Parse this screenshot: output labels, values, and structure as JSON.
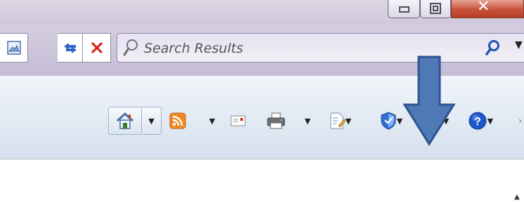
{
  "search": {
    "placeholder": "Search Results"
  },
  "colors": {
    "accent_arrow": "#4f78b6",
    "rss": "#f08a24",
    "close": "#c8523a"
  },
  "icons": {
    "window": [
      "minimize-icon",
      "maximize-icon",
      "close-icon"
    ],
    "nav": [
      "compatibility-view-icon",
      "refresh-icon",
      "stop-icon",
      "search-icon"
    ],
    "command": [
      "home-icon",
      "rss-feed-icon",
      "mail-icon",
      "print-icon",
      "page-icon",
      "safety-shield-icon",
      "tools-gear-icon",
      "help-icon"
    ]
  }
}
